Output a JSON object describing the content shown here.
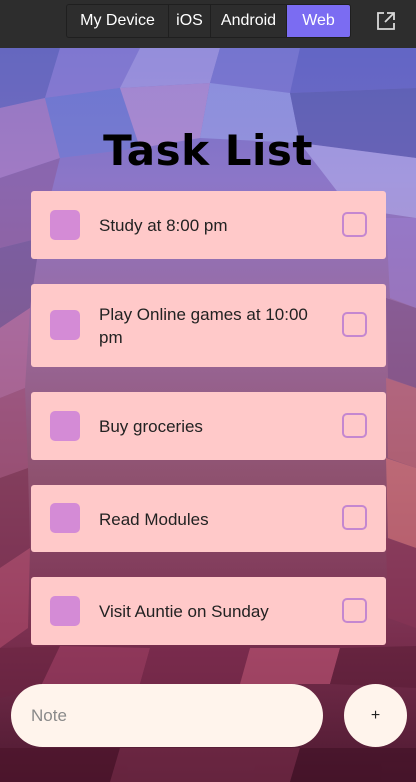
{
  "platform_switcher": {
    "items": [
      "My Device",
      "iOS",
      "Android",
      "Web"
    ],
    "active": "Web"
  },
  "app": {
    "title": "Task List",
    "tasks": [
      {
        "text": "Study at 8:00 pm",
        "checked": false
      },
      {
        "text": "Play Online games at 10:00 pm",
        "checked": false
      },
      {
        "text": "Buy groceries",
        "checked": false
      },
      {
        "text": "Read Modules",
        "checked": false
      },
      {
        "text": "Visit Auntie on Sunday",
        "checked": false
      }
    ],
    "input": {
      "placeholder": "Note",
      "value": ""
    },
    "add_label": "+"
  },
  "colors": {
    "accent": "#7b6cf2",
    "task_bg": "#ffc9c9",
    "task_square": "#d48bd6",
    "checkbox_border": "#c487d0",
    "input_bg": "#fff4ec"
  },
  "icons": {
    "external": "open-in-new-window-icon"
  }
}
